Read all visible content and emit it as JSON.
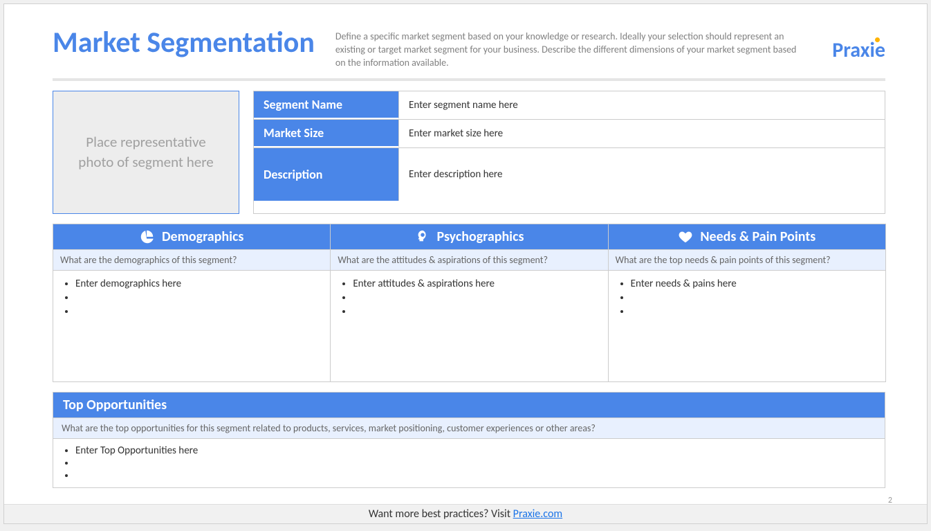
{
  "header": {
    "title": "Market Segmentation",
    "subtitle": "Define a specific market segment based on your knowledge or research. Ideally your selection should represent an existing or target market segment for your business. Describe the different dimensions of your market segment based on the information available.",
    "logo": "Praxie"
  },
  "photo_placeholder": "Place representative photo of segment here",
  "info": {
    "segment_name_label": "Segment Name",
    "segment_name_value": "Enter segment name here",
    "market_size_label": "Market Size",
    "market_size_value": "Enter market size here",
    "description_label": "Description",
    "description_value": "Enter description here"
  },
  "columns": {
    "demographics": {
      "title": "Demographics",
      "sub": "What are the demographics of this segment?",
      "items": [
        "Enter demographics here",
        "",
        ""
      ]
    },
    "psychographics": {
      "title": "Psychographics",
      "sub": "What are the attitudes & aspirations of this segment?",
      "items": [
        "Enter attitudes & aspirations here",
        "",
        ""
      ]
    },
    "needs": {
      "title": "Needs & Pain Points",
      "sub": "What are the top needs & pain points of this segment?",
      "items": [
        "Enter needs & pains here",
        "",
        ""
      ]
    }
  },
  "opportunities": {
    "title": "Top Opportunities",
    "sub": "What are the top opportunities for this segment related to products, services, market positioning, customer experiences or other areas?",
    "items": [
      "Enter Top Opportunities here",
      "",
      ""
    ]
  },
  "footer": {
    "text": "Want more best practices? Visit ",
    "link": "Praxie.com"
  },
  "page_number": "2"
}
